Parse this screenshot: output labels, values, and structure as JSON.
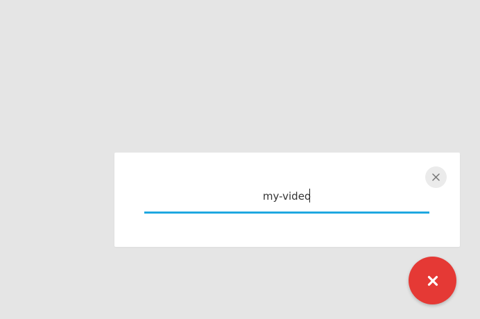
{
  "dialog": {
    "input_value": "my-video",
    "close_icon": "close-icon"
  },
  "fab": {
    "icon": "close-icon",
    "color": "#e53935"
  },
  "colors": {
    "background": "#e5e5e5",
    "panel": "#ffffff",
    "accent_underline": "#1ea8e0",
    "close_button_bg": "#ebebeb"
  }
}
